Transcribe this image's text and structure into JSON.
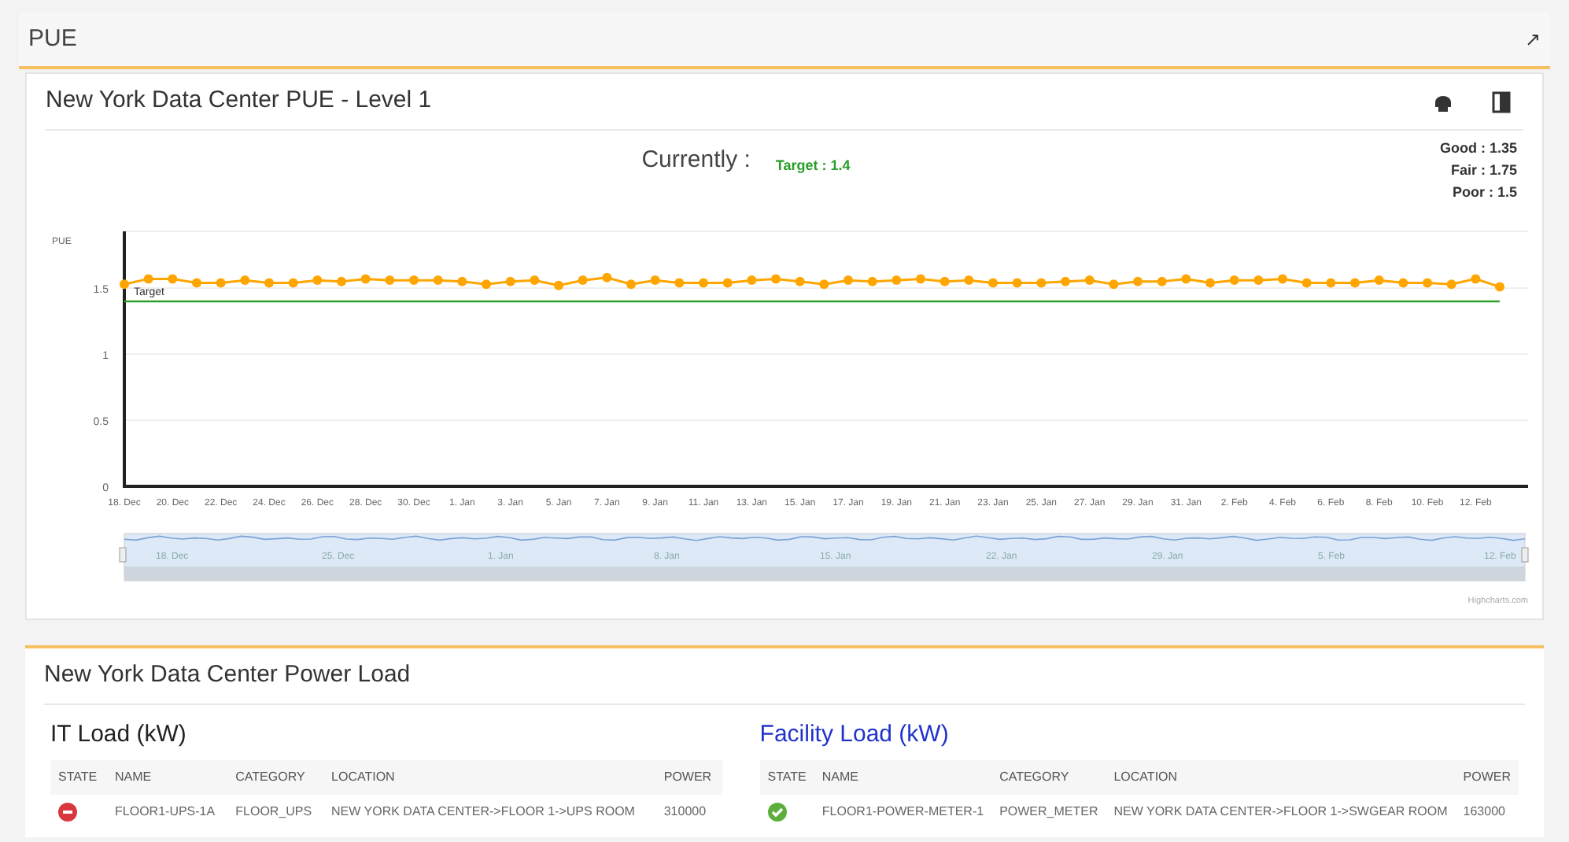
{
  "panel": {
    "title": "PUE",
    "expand_icon": "↗"
  },
  "pue_card": {
    "title": "New York Data Center PUE - Level 1",
    "currently_label": "Currently :",
    "target_label": "Target : 1.4",
    "thresholds": [
      "Good : 1.35",
      "Fair : 1.75",
      "Poor : 1.5"
    ],
    "chart_data": {
      "type": "line",
      "ylabel": "PUE",
      "ylim": [
        0,
        1.93
      ],
      "yticks": [
        0,
        0.5,
        1,
        1.5
      ],
      "grid": true,
      "categories": [
        "18. Dec",
        null,
        "20. Dec",
        null,
        "22. Dec",
        null,
        "24. Dec",
        null,
        "26. Dec",
        null,
        "28. Dec",
        null,
        "30. Dec",
        null,
        "1. Jan",
        null,
        "3. Jan",
        null,
        "5. Jan",
        null,
        "7. Jan",
        null,
        "9. Jan",
        null,
        "11. Jan",
        null,
        "13. Jan",
        null,
        "15. Jan",
        null,
        "17. Jan",
        null,
        "19. Jan",
        null,
        "21. Jan",
        null,
        "23. Jan",
        null,
        "25. Jan",
        null,
        "27. Jan",
        null,
        "29. Jan",
        null,
        "31. Jan",
        null,
        "2. Feb",
        null,
        "4. Feb",
        null,
        "6. Feb",
        null,
        "8. Feb",
        null,
        "10. Feb",
        null,
        "12. Feb",
        null
      ],
      "series": [
        {
          "color": "#ffa500",
          "marker": true,
          "values": [
            1.53,
            1.57,
            1.57,
            1.54,
            1.54,
            1.56,
            1.54,
            1.54,
            1.56,
            1.55,
            1.57,
            1.56,
            1.56,
            1.56,
            1.55,
            1.53,
            1.55,
            1.56,
            1.52,
            1.56,
            1.58,
            1.53,
            1.56,
            1.54,
            1.54,
            1.54,
            1.56,
            1.57,
            1.55,
            1.53,
            1.56,
            1.55,
            1.56,
            1.57,
            1.55,
            1.56,
            1.54,
            1.54,
            1.54,
            1.55,
            1.56,
            1.53,
            1.55,
            1.55,
            1.57,
            1.54,
            1.56,
            1.56,
            1.57,
            1.54,
            1.54,
            1.54,
            1.56,
            1.54,
            1.54,
            1.53,
            1.57,
            1.51
          ]
        },
        {
          "color": "#2ca02c",
          "values": [
            1.4,
            1.4,
            1.4,
            1.4,
            1.4,
            1.4,
            1.4,
            1.4,
            1.4,
            1.4,
            1.4,
            1.4,
            1.4,
            1.4,
            1.4,
            1.4,
            1.4,
            1.4,
            1.4,
            1.4,
            1.4,
            1.4,
            1.4,
            1.4,
            1.4,
            1.4,
            1.4,
            1.4,
            1.4,
            1.4,
            1.4,
            1.4,
            1.4,
            1.4,
            1.4,
            1.4,
            1.4,
            1.4,
            1.4,
            1.4,
            1.4,
            1.4,
            1.4,
            1.4,
            1.4,
            1.4,
            1.4,
            1.4,
            1.4,
            1.4,
            1.4,
            1.4,
            1.4,
            1.4,
            1.4,
            1.4,
            1.4,
            1.4
          ]
        }
      ],
      "annotations": [
        {
          "text": "Target"
        }
      ]
    },
    "navigator_labels": [
      "18. Dec",
      "25. Dec",
      "1. Jan",
      "8. Jan",
      "15. Jan",
      "22. Jan",
      "29. Jan",
      "5. Feb",
      "12. Feb"
    ],
    "credits": "Highcharts.com"
  },
  "power_card": {
    "title": "New York Data Center Power Load",
    "tables": [
      {
        "title": "IT Load (kW)",
        "kind": "it",
        "columns": [
          "STATE",
          "NAME",
          "CATEGORY",
          "LOCATION",
          "POWER"
        ],
        "rows": [
          {
            "alarm": true,
            "name": "FLOOR1-UPS-1A",
            "category": "FLOOR_UPS",
            "location": "NEW YORK DATA CENTER->FLOOR 1->UPS ROOM",
            "power": "310000"
          }
        ]
      },
      {
        "title": "Facility Load (kW)",
        "kind": "facility",
        "columns": [
          "STATE",
          "NAME",
          "CATEGORY",
          "LOCATION",
          "POWER"
        ],
        "rows": [
          {
            "alarm": false,
            "name": "FLOOR1-POWER-METER-1",
            "category": "POWER_METER",
            "location": "NEW YORK DATA CENTER->FLOOR 1->SWGEAR ROOM",
            "power": "163000"
          }
        ]
      }
    ]
  }
}
